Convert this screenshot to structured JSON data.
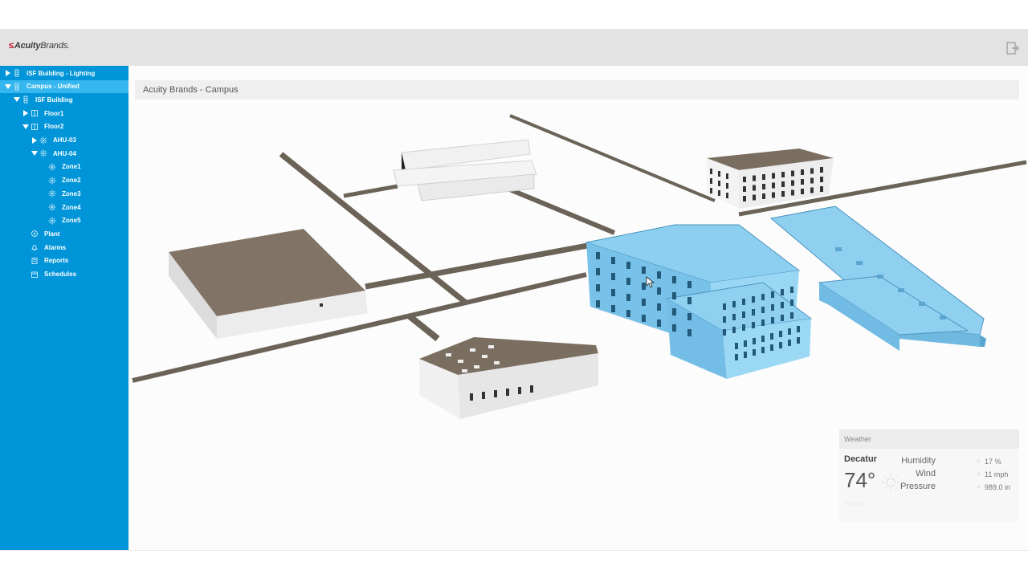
{
  "header": {
    "logo_mark": "≤",
    "logo_text_bold": "Acuity",
    "logo_text": "Brands."
  },
  "sidebar": {
    "items": [
      {
        "label": "ISF Building - Lighting",
        "caret": "right",
        "icon": "building-icon",
        "level": 0
      },
      {
        "label": "Campus - Unified",
        "caret": "down",
        "icon": "building-icon",
        "level": 0,
        "selected": true
      },
      {
        "label": "ISF Building",
        "caret": "down",
        "icon": "building-icon",
        "level": 1
      },
      {
        "label": "Floor1",
        "caret": "right",
        "icon": "floor-icon",
        "level": 2
      },
      {
        "label": "Floor2",
        "caret": "down",
        "icon": "floor-icon",
        "level": 2
      },
      {
        "label": "AHU-03",
        "caret": "right",
        "icon": "fan-icon",
        "level": 3
      },
      {
        "label": "AHU-04",
        "caret": "down",
        "icon": "fan-icon",
        "level": 3
      },
      {
        "label": "Zone1",
        "caret": "none",
        "icon": "fan-icon",
        "level": 4
      },
      {
        "label": "Zone2",
        "caret": "none",
        "icon": "fan-icon",
        "level": 4
      },
      {
        "label": "Zone3",
        "caret": "none",
        "icon": "fan-icon",
        "level": 4
      },
      {
        "label": "Zone4",
        "caret": "none",
        "icon": "fan-icon",
        "level": 4
      },
      {
        "label": "Zone5",
        "caret": "none",
        "icon": "fan-icon",
        "level": 4
      },
      {
        "label": "Plant",
        "caret": "none",
        "icon": "plant-icon",
        "level": 2
      },
      {
        "label": "Alarms",
        "caret": "none",
        "icon": "bell-icon",
        "level": 2
      },
      {
        "label": "Reports",
        "caret": "none",
        "icon": "report-icon",
        "level": 2
      },
      {
        "label": "Schedules",
        "caret": "none",
        "icon": "calendar-icon",
        "level": 2
      }
    ]
  },
  "main": {
    "breadcrumb": "Acuity Brands - Campus"
  },
  "weather": {
    "title": "Weather",
    "city": "Decatur",
    "temperature": "74°",
    "condition": "Sunny",
    "humidity_label": "Humidity",
    "humidity_value": "17 %",
    "wind_label": "Wind",
    "wind_value": "11 mph",
    "pressure_label": "Pressure",
    "pressure_value": "989.0 in"
  },
  "colors": {
    "sidebar": "#0095d8",
    "sidebar_selected": "#35b6ee",
    "highlight_building": "#7ec8ee",
    "roof": "#7a6e60",
    "road": "#6b6357"
  }
}
